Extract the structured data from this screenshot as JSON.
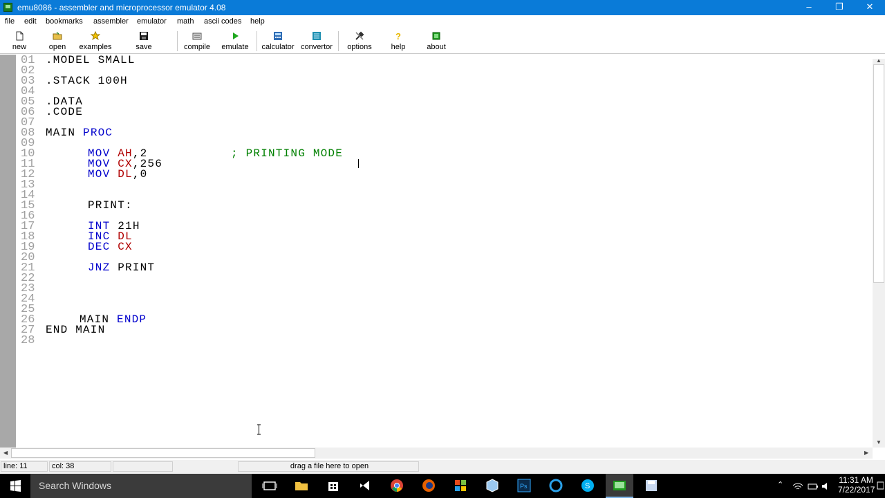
{
  "window": {
    "title": "emu8086 - assembler and microprocessor emulator 4.08",
    "minimize": "–",
    "maximize": "❐",
    "close": "✕"
  },
  "menu": [
    "file",
    "edit",
    "bookmarks",
    "assembler",
    "emulator",
    "math",
    "ascii codes",
    "help"
  ],
  "toolbar": {
    "new": "new",
    "open": "open",
    "examples": "examples",
    "save": "save",
    "compile": "compile",
    "emulate": "emulate",
    "calculator": "calculator",
    "convertor": "convertor",
    "options": "options",
    "help": "help",
    "about": "about",
    "dropdown": "▼"
  },
  "line_numbers": [
    "01",
    "02",
    "03",
    "04",
    "05",
    "06",
    "07",
    "08",
    "09",
    "10",
    "11",
    "12",
    "13",
    "14",
    "15",
    "16",
    "17",
    "18",
    "19",
    "20",
    "21",
    "22",
    "23",
    "24",
    "25",
    "26",
    "27",
    "28"
  ],
  "code": {
    "l01": ".MODEL SMALL",
    "l03": ".STACK 100H",
    "l05": ".DATA",
    "l06": ".CODE",
    "l08_a": "MAIN ",
    "l08_b": "PROC",
    "l10_a": "MOV ",
    "l10_b": "AH",
    "l10_c": ",2",
    "l10_d": "; PRINTING MODE",
    "l11_a": "MOV ",
    "l11_b": "CX",
    "l11_c": ",256",
    "l12_a": "MOV ",
    "l12_b": "DL",
    "l12_c": ",0",
    "l15": "PRINT:",
    "l17_a": "INT ",
    "l17_b": "21H",
    "l18_a": "INC ",
    "l18_b": "DL",
    "l19_a": "DEC ",
    "l19_b": "CX",
    "l21_a": "JNZ ",
    "l21_b": "PRINT",
    "l26_a": "MAIN ",
    "l26_b": "ENDP",
    "l27": "END MAIN"
  },
  "status": {
    "line": "line: 11",
    "col": "col: 38",
    "hint": "drag a file here to open"
  },
  "taskbar": {
    "search_placeholder": "Search Windows",
    "time": "11:31 AM",
    "date": "7/22/2017"
  },
  "colors": {
    "titlebar": "#0a7bd8",
    "keyword": "#0000cc",
    "register": "#b00000",
    "comment": "#008000",
    "line_number": "#a0a0a0"
  }
}
